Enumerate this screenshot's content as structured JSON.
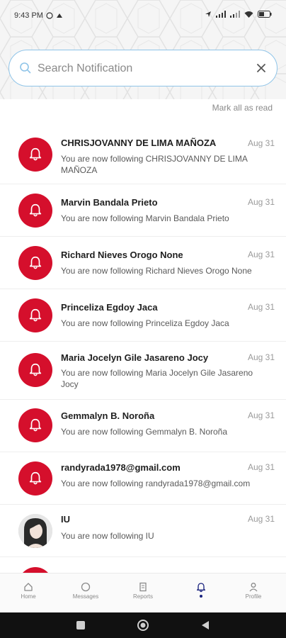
{
  "status_bar": {
    "time": "9:43 PM"
  },
  "search": {
    "placeholder": "Search Notification",
    "value": ""
  },
  "mark_all_label": "Mark all as read",
  "notifications": [
    {
      "name": "CHRISJOVANNY DE LIMA MAÑOZA",
      "date": "Aug 31",
      "message": "You are now following CHRISJOVANNY DE LIMA MAÑOZA",
      "avatar": "bell-icon"
    },
    {
      "name": "Marvin Bandala Prieto",
      "date": "Aug 31",
      "message": "You are now following Marvin Bandala Prieto",
      "avatar": "bell-icon"
    },
    {
      "name": "Richard Nieves Orogo None",
      "date": "Aug 31",
      "message": "You are now following Richard Nieves Orogo None",
      "avatar": "bell-icon"
    },
    {
      "name": "Princeliza Egdoy Jaca",
      "date": "Aug 31",
      "message": "You are now following Princeliza Egdoy Jaca",
      "avatar": "bell-icon"
    },
    {
      "name": "Maria Jocelyn  Gile Jasareno  Jocy",
      "date": "Aug 31",
      "message": "You are now following Maria Jocelyn  Gile Jasareno Jocy",
      "avatar": "bell-icon"
    },
    {
      "name": "Gemmalyn  B. Noroña",
      "date": "Aug 31",
      "message": "You are now following Gemmalyn  B. Noroña",
      "avatar": "bell-icon"
    },
    {
      "name": "randyrada1978@gmail.com",
      "date": "Aug 31",
      "message": "You are now following randyrada1978@gmail.com",
      "avatar": "bell-icon"
    },
    {
      "name": "IU",
      "date": "Aug 31",
      "message": "You are now following IU",
      "avatar": "user-photo"
    }
  ],
  "bottom_nav": [
    {
      "label": "Home",
      "icon": "home-icon"
    },
    {
      "label": "Messages",
      "icon": "chat-icon"
    },
    {
      "label": "Reports",
      "icon": "document-icon"
    },
    {
      "label": "",
      "icon": "bell-icon",
      "active": true
    },
    {
      "label": "Profile",
      "icon": "user-icon"
    }
  ],
  "colors": {
    "accent": "#d50f2c",
    "nav_active": "#1a237e",
    "search_border": "#8fc4e8"
  }
}
